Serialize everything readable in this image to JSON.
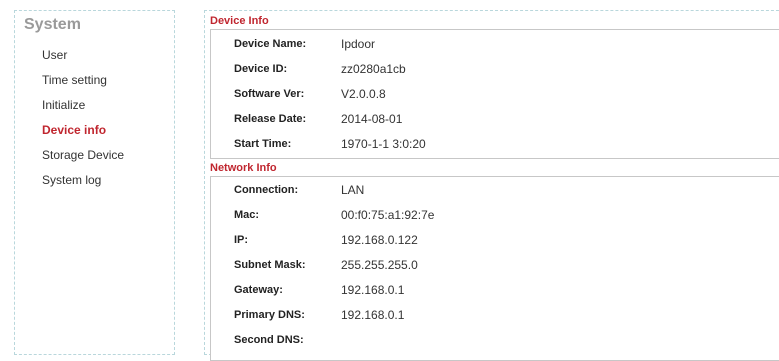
{
  "sidebar": {
    "title": "System",
    "items": [
      {
        "label": "User",
        "active": false
      },
      {
        "label": "Time setting",
        "active": false
      },
      {
        "label": "Initialize",
        "active": false
      },
      {
        "label": "Device info",
        "active": true
      },
      {
        "label": "Storage Device",
        "active": false
      },
      {
        "label": "System log",
        "active": false
      }
    ]
  },
  "device_info": {
    "title": "Device Info",
    "rows": [
      {
        "label": "Device Name:",
        "value": "Ipdoor"
      },
      {
        "label": "Device ID:",
        "value": "zz0280a1cb"
      },
      {
        "label": "Software Ver:",
        "value": "V2.0.0.8"
      },
      {
        "label": "Release Date:",
        "value": "2014-08-01"
      },
      {
        "label": "Start Time:",
        "value": "1970-1-1 3:0:20"
      }
    ]
  },
  "network_info": {
    "title": "Network Info",
    "rows": [
      {
        "label": "Connection:",
        "value": "LAN"
      },
      {
        "label": "Mac:",
        "value": "00:f0:75:a1:92:7e"
      },
      {
        "label": "IP:",
        "value": "192.168.0.122"
      },
      {
        "label": "Subnet Mask:",
        "value": "255.255.255.0"
      },
      {
        "label": "Gateway:",
        "value": "192.168.0.1"
      },
      {
        "label": "Primary DNS:",
        "value": "192.168.0.1"
      },
      {
        "label": "Second DNS:",
        "value": ""
      }
    ]
  },
  "colors": {
    "accent": "#c0262f",
    "sidebar_title": "#9a9a9a",
    "dashed_border": "#b9d7dc"
  }
}
